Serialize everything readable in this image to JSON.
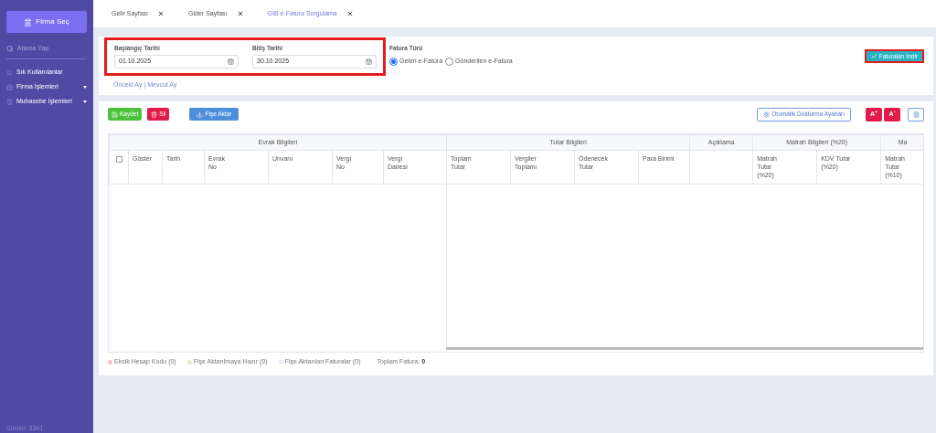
{
  "sidebar": {
    "company_button": "Firma Seç",
    "search": {
      "placeholder": "Arama Yap"
    },
    "items": [
      {
        "label": "Sık Kullanılanlar",
        "has_submenu": false
      },
      {
        "label": "Firma İşlemleri",
        "has_submenu": true
      },
      {
        "label": "Muhasebe İşlemleri",
        "has_submenu": true
      }
    ],
    "footer": "Sürüm: 3341"
  },
  "tabs": [
    {
      "label": "Gelir Sayfası",
      "selected": false
    },
    {
      "label": "Gider Sayfası",
      "selected": false
    },
    {
      "label": "GİB e-Fatura Sorgulama",
      "selected": true
    }
  ],
  "filters": {
    "start_date": {
      "label": "Başlangıç Tarihi",
      "value": "01.10.2025"
    },
    "end_date": {
      "label": "Bitiş Tarihi",
      "value": "30.10.2025"
    },
    "links": [
      "Önceki Ay",
      "Mevcut Ay"
    ],
    "link_separator": "|",
    "invoice_type": {
      "label": "Fatura Türü",
      "options": [
        {
          "label": "Gelen e-Fatura",
          "selected": true
        },
        {
          "label": "Gönderilen e-Fatura",
          "selected": false
        }
      ]
    },
    "download_button": "Faturaları İndir"
  },
  "toolbar": {
    "save": "Kaydet",
    "delete": "Sil",
    "transfer": "Fişe Aktar",
    "autofill": "Otomatik Doldurma Ayarları",
    "font_up": "A$^{+}$",
    "font_down": "A$^{-}$"
  },
  "table": {
    "groups": [
      {
        "label": "Evrak Bilgileri",
        "columns": [
          "",
          "Göster",
          "Tarih",
          "Evrak\nNo",
          "Unvanı",
          "Vergi\nNo",
          "Vergi\nDairesi"
        ]
      },
      {
        "label": "Tutar Bilgileri",
        "columns": [
          "Toplam\nTutar",
          "Vergiler\nToplamı",
          "Ödenecek\nTutar",
          "Para Birimi"
        ]
      },
      {
        "label": "Açıklama",
        "columns": [
          ""
        ]
      },
      {
        "label": "Matrah Bilgileri (%20)",
        "columns": [
          "Matrah\nTutar\n(%20)",
          "KDV Tutar\n(%20)"
        ]
      },
      {
        "label": "Ma",
        "columns": [
          "Matrah\nTutar\n(%10)"
        ]
      }
    ],
    "select_all_checked": false
  },
  "legend": [
    {
      "label": "Eksik Hesap Kodu (0)",
      "color": "#f8bbd0"
    },
    {
      "label": "Fişe Aktarılmaya Hazır (0)",
      "color": "#dcedc8"
    },
    {
      "label": "Fişe Aktarılan Faturalar (0)",
      "color": "#e3ecfa"
    }
  ],
  "total": {
    "label": "Toplam Fatura:",
    "value": "0"
  }
}
